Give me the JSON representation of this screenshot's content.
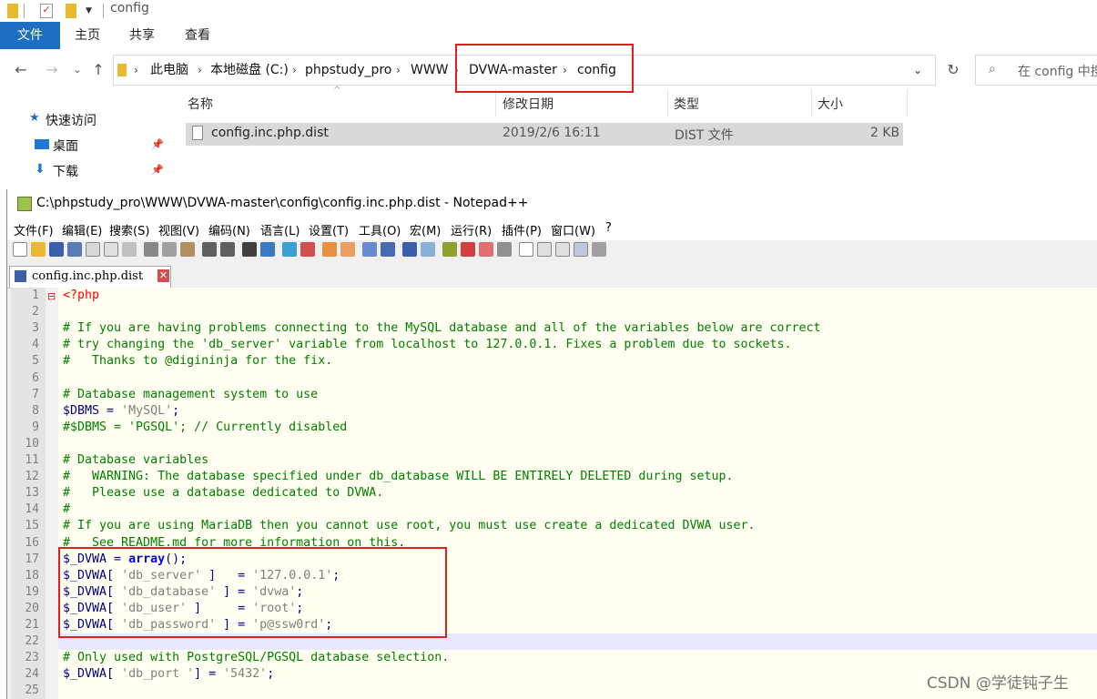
{
  "explorer": {
    "title": "config",
    "ribbon_tabs": [
      "文件",
      "主页",
      "共享",
      "查看"
    ],
    "breadcrumbs": [
      "此电脑",
      "本地磁盘 (C:)",
      "phpstudy_pro",
      "WWW",
      "DVWA-master",
      "config"
    ],
    "search_placeholder": "在 config 中搜",
    "nav_items": [
      "快速访问",
      "桌面",
      "下载"
    ],
    "columns": [
      "名称",
      "修改日期",
      "类型",
      "大小"
    ],
    "files": [
      {
        "name": "config.inc.php.dist",
        "modified": "2019/2/6 16:11",
        "type": "DIST 文件",
        "size": "2 KB"
      }
    ]
  },
  "notepad": {
    "title": "C:\\phpstudy_pro\\WWW\\DVWA-master\\config\\config.inc.php.dist - Notepad++",
    "menu": [
      "文件(F)",
      "编辑(E)",
      "搜索(S)",
      "视图(V)",
      "编码(N)",
      "语言(L)",
      "设置(T)",
      "工具(O)",
      "宏(M)",
      "运行(R)",
      "插件(P)",
      "窗口(W)",
      "?"
    ],
    "tab_label": "config.inc.php.dist",
    "lines": [
      {
        "n": "1",
        "parts": [
          [
            "php",
            "<?php"
          ]
        ]
      },
      {
        "n": "2",
        "parts": []
      },
      {
        "n": "3",
        "parts": [
          [
            "cm",
            "# If you are having problems connecting to the MySQL database and all of the variables below are correct"
          ]
        ]
      },
      {
        "n": "4",
        "parts": [
          [
            "cm",
            "# try changing the 'db_server' variable from localhost to 127.0.0.1. Fixes a problem due to sockets."
          ]
        ]
      },
      {
        "n": "5",
        "parts": [
          [
            "cm",
            "#   Thanks to @digininja for the fix."
          ]
        ]
      },
      {
        "n": "6",
        "parts": []
      },
      {
        "n": "7",
        "parts": [
          [
            "cm",
            "# Database management system to use"
          ]
        ]
      },
      {
        "n": "8",
        "parts": [
          [
            "var",
            "$DBMS"
          ],
          [
            "op",
            " = "
          ],
          [
            "str",
            "'MySQL'"
          ],
          [
            "op",
            ";"
          ]
        ]
      },
      {
        "n": "9",
        "parts": [
          [
            "cm",
            "#$DBMS = 'PGSQL'; // Currently disabled"
          ]
        ]
      },
      {
        "n": "10",
        "parts": []
      },
      {
        "n": "11",
        "parts": [
          [
            "cm",
            "# Database variables"
          ]
        ]
      },
      {
        "n": "12",
        "parts": [
          [
            "cm",
            "#   WARNING: The database specified under db_database WILL BE ENTIRELY DELETED during setup."
          ]
        ]
      },
      {
        "n": "13",
        "parts": [
          [
            "cm",
            "#   Please use a database dedicated to DVWA."
          ]
        ]
      },
      {
        "n": "14",
        "parts": [
          [
            "cm",
            "#"
          ]
        ]
      },
      {
        "n": "15",
        "parts": [
          [
            "cm",
            "# If you are using MariaDB then you cannot use root, you must use create a dedicated DVWA user."
          ]
        ]
      },
      {
        "n": "16",
        "parts": [
          [
            "cm",
            "#   See README.md for more information on this."
          ]
        ]
      },
      {
        "n": "17",
        "parts": [
          [
            "var",
            "$_DVWA"
          ],
          [
            "op",
            " = "
          ],
          [
            "kw",
            "array"
          ],
          [
            "op",
            "();"
          ]
        ]
      },
      {
        "n": "18",
        "parts": [
          [
            "var",
            "$_DVWA"
          ],
          [
            "op",
            "[ "
          ],
          [
            "str",
            "'db_server'"
          ],
          [
            "op",
            " ]   = "
          ],
          [
            "str",
            "'127.0.0.1'"
          ],
          [
            "op",
            ";"
          ]
        ]
      },
      {
        "n": "19",
        "parts": [
          [
            "var",
            "$_DVWA"
          ],
          [
            "op",
            "[ "
          ],
          [
            "str",
            "'db_database'"
          ],
          [
            "op",
            " ] = "
          ],
          [
            "str",
            "'dvwa'"
          ],
          [
            "op",
            ";"
          ]
        ]
      },
      {
        "n": "20",
        "parts": [
          [
            "var",
            "$_DVWA"
          ],
          [
            "op",
            "[ "
          ],
          [
            "str",
            "'db_user'"
          ],
          [
            "op",
            " ]     = "
          ],
          [
            "str",
            "'root'"
          ],
          [
            "op",
            ";"
          ]
        ]
      },
      {
        "n": "21",
        "parts": [
          [
            "var",
            "$_DVWA"
          ],
          [
            "op",
            "[ "
          ],
          [
            "str",
            "'db_password'"
          ],
          [
            "op",
            " ] = "
          ],
          [
            "str",
            "'p@ssw0rd'"
          ],
          [
            "op",
            ";"
          ]
        ]
      },
      {
        "n": "22",
        "parts": []
      },
      {
        "n": "23",
        "parts": [
          [
            "cm",
            "# Only used with PostgreSQL/PGSQL database selection."
          ]
        ]
      },
      {
        "n": "24",
        "parts": [
          [
            "var",
            "$_DVWA"
          ],
          [
            "op",
            "[ "
          ],
          [
            "str",
            "'db_port '"
          ],
          [
            "op",
            "] = "
          ],
          [
            "str",
            "'5432'"
          ],
          [
            "op",
            ";"
          ]
        ]
      },
      {
        "n": "25",
        "parts": []
      }
    ]
  },
  "watermark": "CSDN @学徒钝子生",
  "colors": {
    "accent": "#1e6fc2",
    "highlight_box": "#e02020",
    "comment": "#008000",
    "keyword": "#0000ff"
  }
}
